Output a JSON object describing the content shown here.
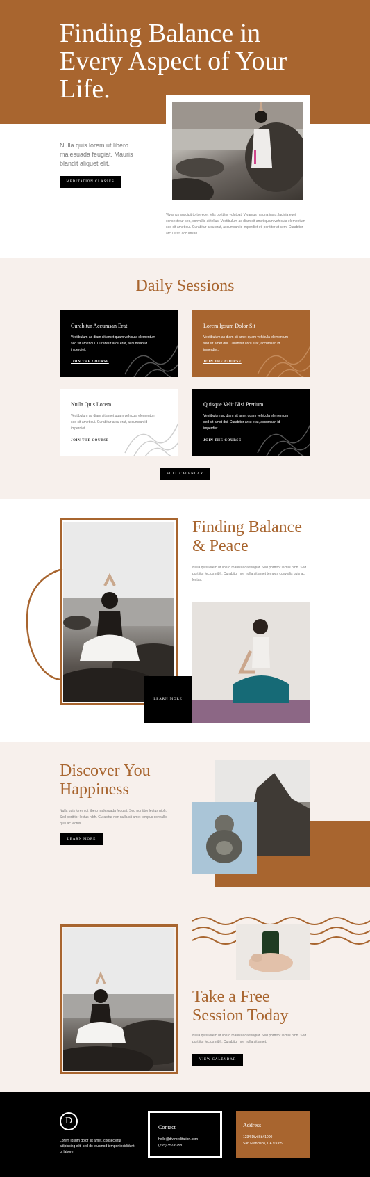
{
  "colors": {
    "accent": "#a8652f",
    "cream": "#f7f0ec",
    "dark": "#000000"
  },
  "hero": {
    "title": "Finding Balance in Every Aspect of Your Life.",
    "text": "Nulla quis lorem ut libero malesuada feugiat. Mauris blandit aliquet elit.",
    "button": "Meditation Classes",
    "caption": "Vivamus suscipit tortor eget felis porttitor volutpat. Vivamus magna justo, lacinia eget consectetur sed, convallis at tellus. Vestibulum ac diam sit amet quam vehicula elementum sed sit amet dui. Curabitur arcu erat, accumsan id imperdiet et, porttitor at sem. Curabitur arcu erat, accumsan."
  },
  "sessions": {
    "title": "Daily Sessions",
    "cards": [
      {
        "title": "Curabitur Accumsan Erat",
        "text": "Vestibulum ac diam sit amet quam vehicula elementum sed sit amet dui. Curabitur arcu erat, accumsan id imperdiet.",
        "link": "Join the Course"
      },
      {
        "title": "Lorem Ipsum Dolor Sit",
        "text": "Vestibulum ac diam sit amet quam vehicula elementum sed sit amet dui. Curabitur arcu erat, accumsan id imperdiet.",
        "link": "Join the Course"
      },
      {
        "title": "Nulla Quis Lorem",
        "text": "Vestibulum ac diam sit amet quam vehicula elementum sed sit amet dui. Curabitur arcu erat, accumsan id imperdiet.",
        "link": "Join the Course"
      },
      {
        "title": "Quisque Velit Nisi Pretium",
        "text": "Vestibulum ac diam sit amet quam vehicula elementum sed sit amet dui. Curabitur arcu erat, accumsan id imperdiet.",
        "link": "Join the Course"
      }
    ],
    "button": "Full Calendar"
  },
  "peace": {
    "title": "Finding Balance & Peace",
    "text": "Nulla quis lorem ut libero malesuada feugiat. Sed porttitor lectus nibh. Sed porttitor lectus nibh. Curabitur non nulla sit amet tempus convallis quis ac lectus.",
    "button": "Learn More"
  },
  "discover": {
    "title": "Discover You Happiness",
    "text": "Nulla quis lorem ut libero malesuada feugiat. Sed porttitor lectus nibh. Sed porttitor lectus nibh. Curabitur non nulla sit amet tempus convallis quis ac lectus.",
    "button": "Learn More"
  },
  "free": {
    "title": "Take a Free Session Today",
    "text": "Nulla quis lorem ut libero malesuada feugiat. Sed porttitor lectus nibh. Sed porttitor lectus nibh. Curabitur non nulla sit amet.",
    "button": "View Calendar"
  },
  "footer": {
    "logo": "D",
    "text": "Lorem ipsum dolor sit amet, consectetur adipiscing elit, sed do eiusmod tempor incididunt ut labore.",
    "contact": {
      "title": "Contact",
      "email": "hello@divimeditation.com",
      "phone": "(255) 352-6258"
    },
    "address": {
      "title": "Address",
      "line1": "1234 Divi St #1000",
      "line2": "San Francisco, CA 93065"
    }
  }
}
